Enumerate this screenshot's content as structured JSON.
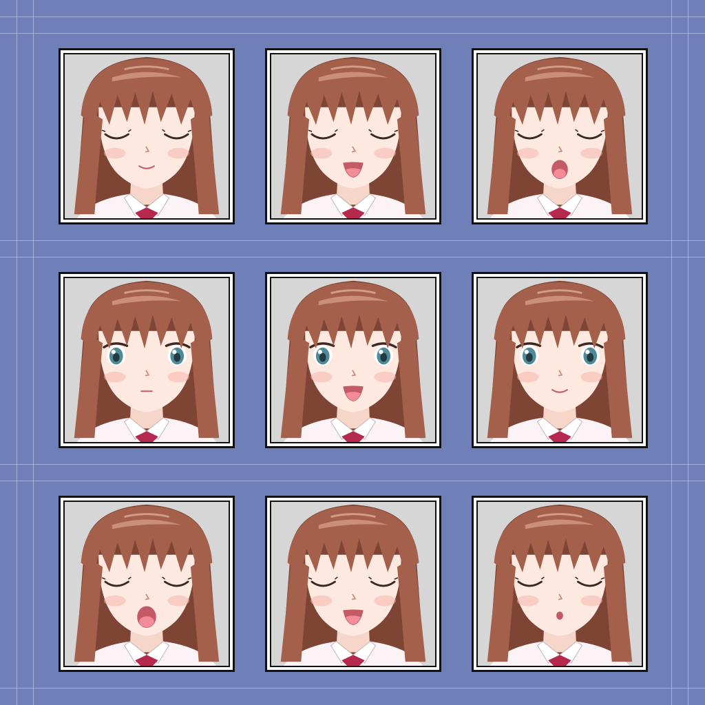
{
  "colors": {
    "background": "#6f80b9",
    "guide": "#dfe6ff",
    "frame_bg": "#d6d6d6",
    "hair": "#a4604a",
    "hair_dark": "#7e4434",
    "skin": "#fde9df",
    "blush": "#f6b5ad",
    "eye_iris": "#4f8a98",
    "mouth": "#c45a66",
    "tongue": "#f28c98",
    "ribbon": "#b5294f"
  },
  "portraits": [
    {
      "eyes": "closed",
      "mouth": "smile"
    },
    {
      "eyes": "closed",
      "mouth": "open_smile"
    },
    {
      "eyes": "closed",
      "mouth": "open_o"
    },
    {
      "eyes": "open",
      "mouth": "small_neutral"
    },
    {
      "eyes": "open",
      "mouth": "open_smile"
    },
    {
      "eyes": "open",
      "mouth": "smile"
    },
    {
      "eyes": "closed",
      "mouth": "open_wide"
    },
    {
      "eyes": "closed",
      "mouth": "open_smile"
    },
    {
      "eyes": "closed",
      "mouth": "small_o"
    }
  ]
}
